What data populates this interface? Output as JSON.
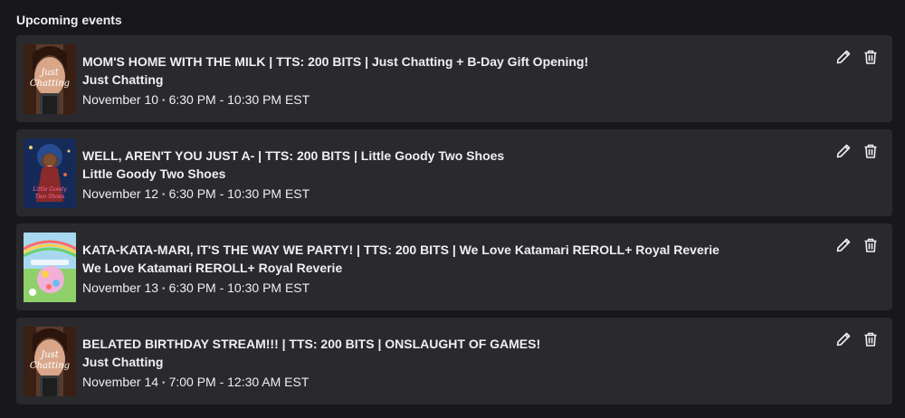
{
  "header": {
    "title": "Upcoming events"
  },
  "events": [
    {
      "title": "MOM'S HOME WITH THE MILK | TTS: 200 BITS | Just Chatting + B-Day Gift Opening!",
      "category": "Just Chatting",
      "date": "November 10",
      "time": "6:30 PM - 10:30 PM EST",
      "thumbnail": "just-chatting",
      "thumb_text": [
        "Just",
        "Chatting"
      ]
    },
    {
      "title": "WELL, AREN'T YOU JUST A- | TTS: 200 BITS | Little Goody Two Shoes",
      "category": "Little Goody Two Shoes",
      "date": "November 12",
      "time": "6:30 PM - 10:30 PM EST",
      "thumbnail": "little-goody-two-shoes",
      "thumb_text": [
        "Little Goody",
        "Two Shoes"
      ]
    },
    {
      "title": "KATA-KATA-MARI, IT'S THE WAY WE PARTY! | TTS: 200 BITS | We Love Katamari REROLL+ Royal Reverie",
      "category": "We Love Katamari REROLL+ Royal Reverie",
      "date": "November 13",
      "time": "6:30 PM - 10:30 PM EST",
      "thumbnail": "we-love-katamari",
      "thumb_text": []
    },
    {
      "title": "BELATED BIRTHDAY STREAM!!! | TTS: 200 BITS | ONSLAUGHT OF GAMES!",
      "category": "Just Chatting",
      "date": "November 14",
      "time": "7:00 PM - 12:30 AM EST",
      "thumbnail": "just-chatting",
      "thumb_text": [
        "Just",
        "Chatting"
      ]
    }
  ],
  "icons": {
    "edit": "pencil-icon",
    "delete": "trash-icon"
  },
  "colors": {
    "background": "#18181b",
    "card": "#2a2a2e",
    "text": "#efeff1",
    "muted": "#adadb8"
  }
}
